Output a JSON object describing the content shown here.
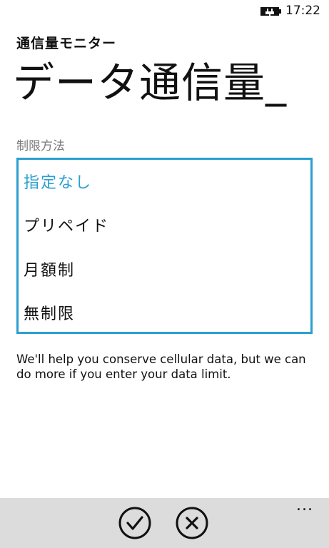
{
  "status_bar": {
    "time": "17:22",
    "battery_icon": "battery-charging-icon"
  },
  "header": {
    "app_title": "通信量モニター",
    "page_title": "データ通信量_"
  },
  "picker": {
    "label": "制限方法",
    "options": [
      "指定なし",
      "プリペイド",
      "月額制",
      "無制限"
    ],
    "selected": "指定なし"
  },
  "help_text": "We'll help you conserve cellular data, but we can do more if you enter your data limit.",
  "app_bar": {
    "ok_icon": "check-circle-icon",
    "cancel_icon": "close-circle-icon",
    "more_label": "..."
  },
  "colors": {
    "accent": "#2b9fd0",
    "app_bar_bg": "#dcdcdc",
    "label_gray": "#7a7a7a"
  }
}
